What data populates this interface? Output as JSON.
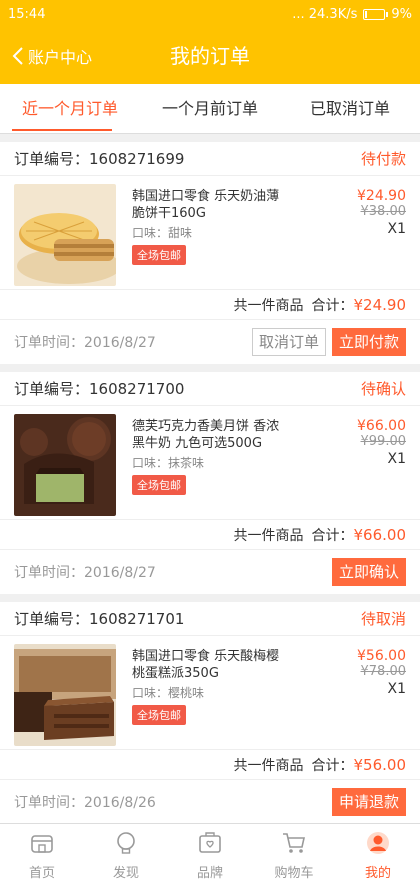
{
  "status_bar": {
    "time": "15:44",
    "network": "... 24.3K/s",
    "battery": "9%"
  },
  "header": {
    "back_label": "账户中心",
    "title": "我的订单"
  },
  "tabs": [
    {
      "label": "近一个月订单",
      "active": true
    },
    {
      "label": "一个月前订单",
      "active": false
    },
    {
      "label": "已取消订单",
      "active": false
    }
  ],
  "orders": [
    {
      "order_no": "订单编号：1608271699",
      "status": "待付款",
      "product": "韩国进口零食 乐天奶油薄脆饼干160G",
      "flavor": "口味：甜味",
      "tag": "全场包邮",
      "price": "¥24.90",
      "old_price": "¥38.00",
      "qty": "X1",
      "count_text": "共一件商品",
      "total_label": "合计：",
      "total": "¥24.90",
      "time": "订单时间：2016/8/27",
      "buttons": [
        "取消订单",
        "立即付款"
      ]
    },
    {
      "order_no": "订单编号：1608271700",
      "status": "待确认",
      "product": "德芙巧克力香美月饼 香浓黑牛奶 九色可选500G",
      "flavor": "口味：抹茶味",
      "tag": "全场包邮",
      "price": "¥66.00",
      "old_price": "¥99.00",
      "qty": "X1",
      "count_text": "共一件商品",
      "total_label": "合计：",
      "total": "¥66.00",
      "time": "订单时间：2016/8/27",
      "buttons": [
        "立即确认"
      ]
    },
    {
      "order_no": "订单编号：1608271701",
      "status": "待取消",
      "product": "韩国进口零食 乐天酸梅樱桃蛋糕派350G",
      "flavor": "口味：樱桃味",
      "tag": "全场包邮",
      "price": "¥56.00",
      "old_price": "¥78.00",
      "qty": "X1",
      "count_text": "共一件商品",
      "total_label": "合计：",
      "total": "¥56.00",
      "time": "订单时间：2016/8/26",
      "buttons": [
        "申请退款"
      ]
    }
  ],
  "bottom_nav": [
    {
      "label": "首页",
      "icon": "home-icon"
    },
    {
      "label": "发现",
      "icon": "bulb-icon"
    },
    {
      "label": "品牌",
      "icon": "brand-icon"
    },
    {
      "label": "购物车",
      "icon": "cart-icon"
    },
    {
      "label": "我的",
      "icon": "profile-icon",
      "active": true
    }
  ],
  "colors": {
    "brand_yellow": "#ffc300",
    "accent_orange": "#ff5a2c"
  }
}
